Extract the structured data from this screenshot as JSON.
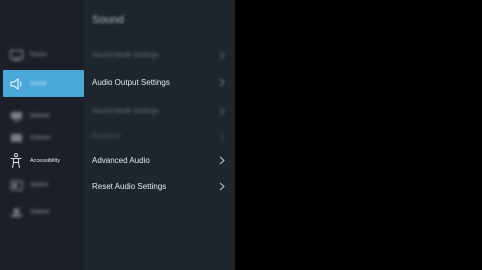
{
  "sidebar": {
    "items": [
      {
        "label": "Picture",
        "icon": "picture-icon"
      },
      {
        "label": "Sound",
        "icon": "sound-icon"
      },
      {
        "label": "Network",
        "icon": "network-icon"
      },
      {
        "label": "Channel",
        "icon": "channel-icon"
      },
      {
        "label": "Accessibility",
        "icon": "accessibility-icon"
      },
      {
        "label": "System",
        "icon": "system-icon"
      },
      {
        "label": "Support",
        "icon": "support-icon"
      }
    ]
  },
  "main": {
    "title": "Sound",
    "items": [
      {
        "label": "Sound Mode Settings"
      },
      {
        "label": "Audio Output Settings"
      },
      {
        "label": "Sound Mode Settings"
      },
      {
        "label": "Equalizer"
      },
      {
        "label": "Advanced Audio"
      },
      {
        "label": "Reset Audio Settings"
      }
    ]
  },
  "colors": {
    "accent": "#4aa8d8",
    "sidebar_bg": "#1b2028",
    "panel_bg": "#1f252d",
    "background": "#000000"
  }
}
